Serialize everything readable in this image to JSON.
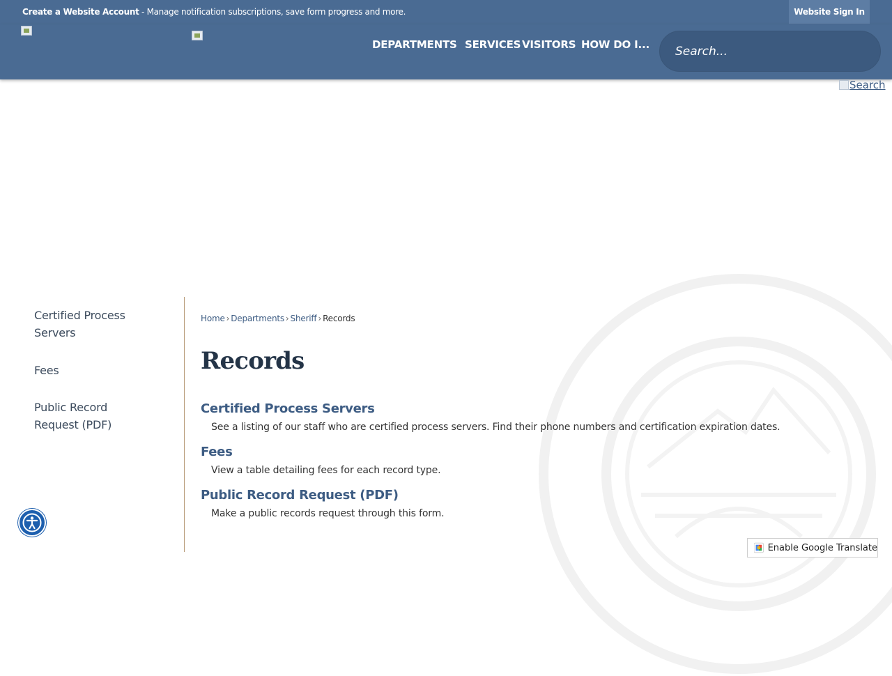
{
  "topbar": {
    "account_link": "Create a Website Account",
    "account_text": " - Manage notification subscriptions, save form progress and more.",
    "signin_label": "Website Sign In"
  },
  "nav": {
    "items": [
      "DEPARTMENTS",
      "SERVICES",
      "VISITORS",
      "HOW DO I..."
    ]
  },
  "search": {
    "placeholder": "Search...",
    "link_alt": "Search"
  },
  "sidebar": {
    "items": [
      {
        "label": "Certified Process Servers"
      },
      {
        "label": "Fees"
      },
      {
        "label": "Public Record Request (PDF)"
      }
    ]
  },
  "breadcrumb": {
    "items": [
      "Home",
      "Departments",
      "Sheriff"
    ],
    "current": "Records",
    "separator": "›"
  },
  "page": {
    "title": "Records",
    "links": [
      {
        "title": "Certified Process Servers",
        "description": "See a listing of our staff who are certified process servers. Find their phone numbers and certification expiration dates."
      },
      {
        "title": "Fees",
        "description": "View a table detailing fees for each record type."
      },
      {
        "title": "Public Record Request (PDF)",
        "description": "Make a public records request through this form."
      }
    ]
  },
  "translate": {
    "label": "Enable Google Translate"
  },
  "colors": {
    "header_bg": "#4a6b93",
    "signin_bg": "#5d7da4",
    "link": "#3d5c83",
    "title": "#243447",
    "sidebar_border": "#b79a78",
    "a11y_bg": "#1d5fae"
  },
  "icons": {
    "accessibility": "accessibility-person-icon",
    "translate": "google-translate-icon",
    "seal": "county-seal-watermark"
  }
}
